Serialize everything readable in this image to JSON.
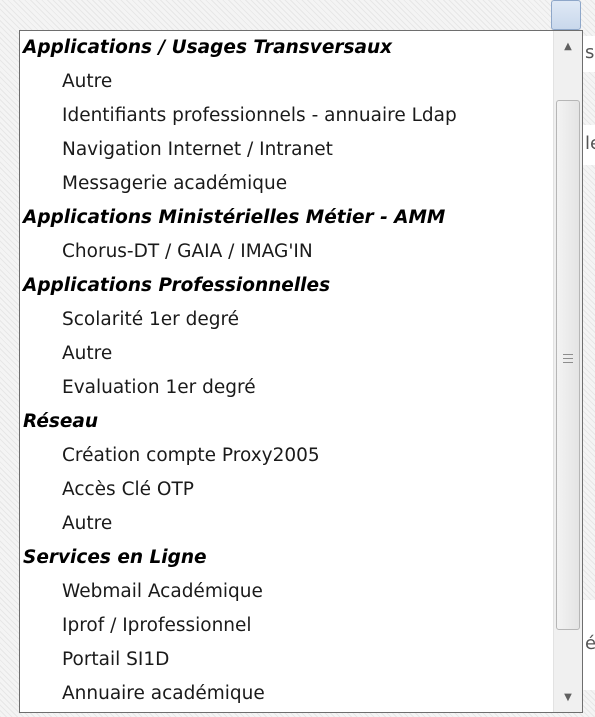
{
  "background": {
    "right_edge_fragments": [
      "s",
      "le",
      "é"
    ]
  },
  "dropdown": {
    "rows": [
      {
        "type": "group",
        "label": "Applications / Usages Transversaux"
      },
      {
        "type": "option",
        "label": "Autre"
      },
      {
        "type": "option",
        "label": "Identifiants professionnels - annuaire Ldap"
      },
      {
        "type": "option",
        "label": "Navigation Internet / Intranet"
      },
      {
        "type": "option",
        "label": "Messagerie académique"
      },
      {
        "type": "group",
        "label": "Applications Ministérielles Métier - AMM"
      },
      {
        "type": "option",
        "label": "Chorus-DT / GAIA / IMAG'IN"
      },
      {
        "type": "group",
        "label": "Applications Professionnelles"
      },
      {
        "type": "option",
        "label": "Scolarité 1er degré"
      },
      {
        "type": "option",
        "label": "Autre"
      },
      {
        "type": "option",
        "label": "Evaluation 1er degré"
      },
      {
        "type": "group",
        "label": "Réseau"
      },
      {
        "type": "option",
        "label": "Création compte Proxy2005"
      },
      {
        "type": "option",
        "label": "Accès Clé OTP"
      },
      {
        "type": "option",
        "label": "Autre"
      },
      {
        "type": "group",
        "label": "Services en Ligne"
      },
      {
        "type": "option",
        "label": "Webmail Académique"
      },
      {
        "type": "option",
        "label": "Iprof / Iprofessionnel"
      },
      {
        "type": "option",
        "label": "Portail SI1D"
      },
      {
        "type": "option",
        "label": "Annuaire académique"
      }
    ]
  },
  "scrollbar": {
    "up_icon": "triangle-up-icon",
    "down_icon": "triangle-down-icon",
    "grip_icon": "grip-lines-icon",
    "thumb_start_fraction": 0.1,
    "thumb_size_fraction": 0.78
  }
}
